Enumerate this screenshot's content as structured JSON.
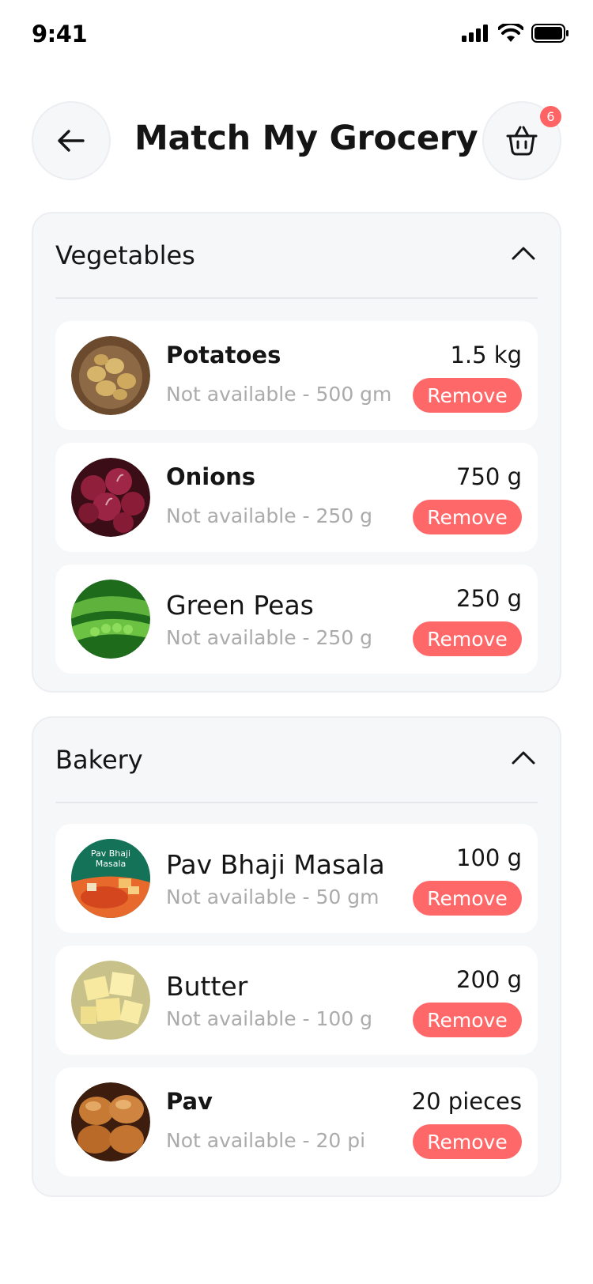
{
  "status": {
    "time": "9:41"
  },
  "header": {
    "title": "Match My Grocery",
    "cart_count": "6"
  },
  "sections": [
    {
      "title": "Vegetables",
      "items": [
        {
          "name": "Potatoes",
          "availability": "Not available - 500 gm",
          "quantity": "1.5 kg",
          "remove_label": "Remove",
          "image": "potatoes-photo"
        },
        {
          "name": "Onions",
          "availability": "Not available - 250 g",
          "quantity": "750 g",
          "remove_label": "Remove",
          "image": "onions-photo"
        },
        {
          "name": "Green Peas",
          "availability": "Not available - 250 g",
          "quantity": "250 g",
          "remove_label": "Remove",
          "image": "green-peas-photo"
        }
      ]
    },
    {
      "title": "Bakery",
      "items": [
        {
          "name": "Pav Bhaji Masala",
          "availability": "Not available - 50 gm",
          "quantity": "100 g",
          "remove_label": "Remove",
          "image": "pav-bhaji-masala-photo",
          "image_text": "Pav Bhaji Masala"
        },
        {
          "name": "Butter",
          "availability": "Not available - 100 g",
          "quantity": "200 g",
          "remove_label": "Remove",
          "image": "butter-photo"
        },
        {
          "name": "Pav",
          "availability": "Not available - 20 pi",
          "quantity": "20 pieces",
          "remove_label": "Remove",
          "image": "pav-photo"
        }
      ]
    }
  ],
  "colors": {
    "accent": "#ff6868",
    "badge": "#ff6363",
    "card_bg": "#f6f7f9",
    "muted_text": "#ababab"
  }
}
